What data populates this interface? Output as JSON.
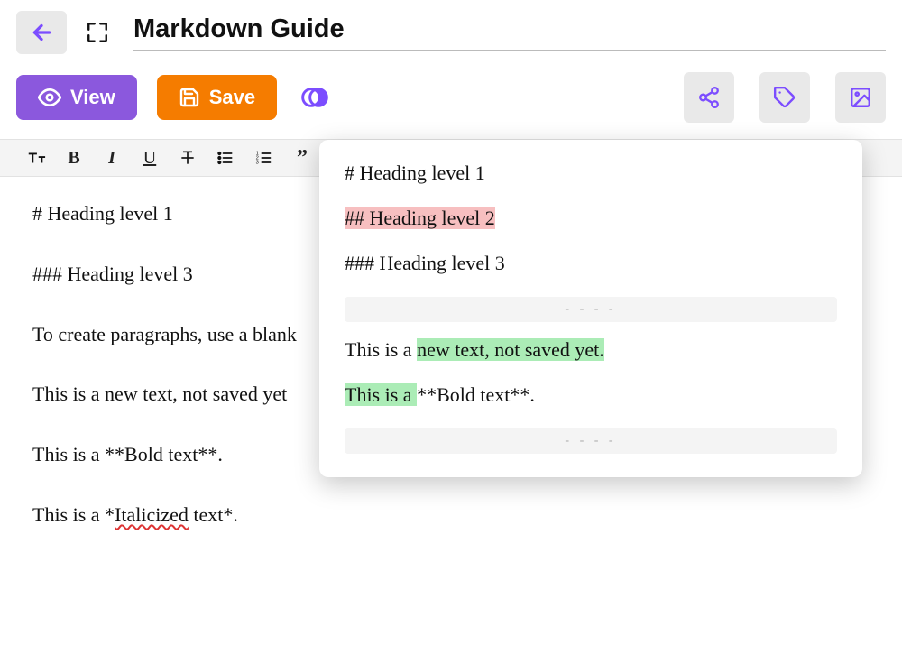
{
  "header": {
    "title": "Markdown Guide"
  },
  "actions": {
    "view_label": "View",
    "save_label": "Save"
  },
  "editor": {
    "lines": [
      "# Heading level 1",
      "### Heading level 3",
      "To create paragraphs, use a blank",
      "This is a new text, not saved yet",
      "This is a **Bold text**."
    ],
    "italic_line_prefix": "This is a *",
    "italic_word": "Italicized",
    "italic_line_suffix": " text*."
  },
  "diff": {
    "line1": "# Heading level 1",
    "line2_del": "## Heading level 2",
    "line3": "### Heading level 3",
    "hr": "- - - -",
    "line4_pre": "This is a ",
    "line4_add": "new text, not saved yet.",
    "line5_add": "This is a ",
    "line5_post": "**Bold text**."
  }
}
